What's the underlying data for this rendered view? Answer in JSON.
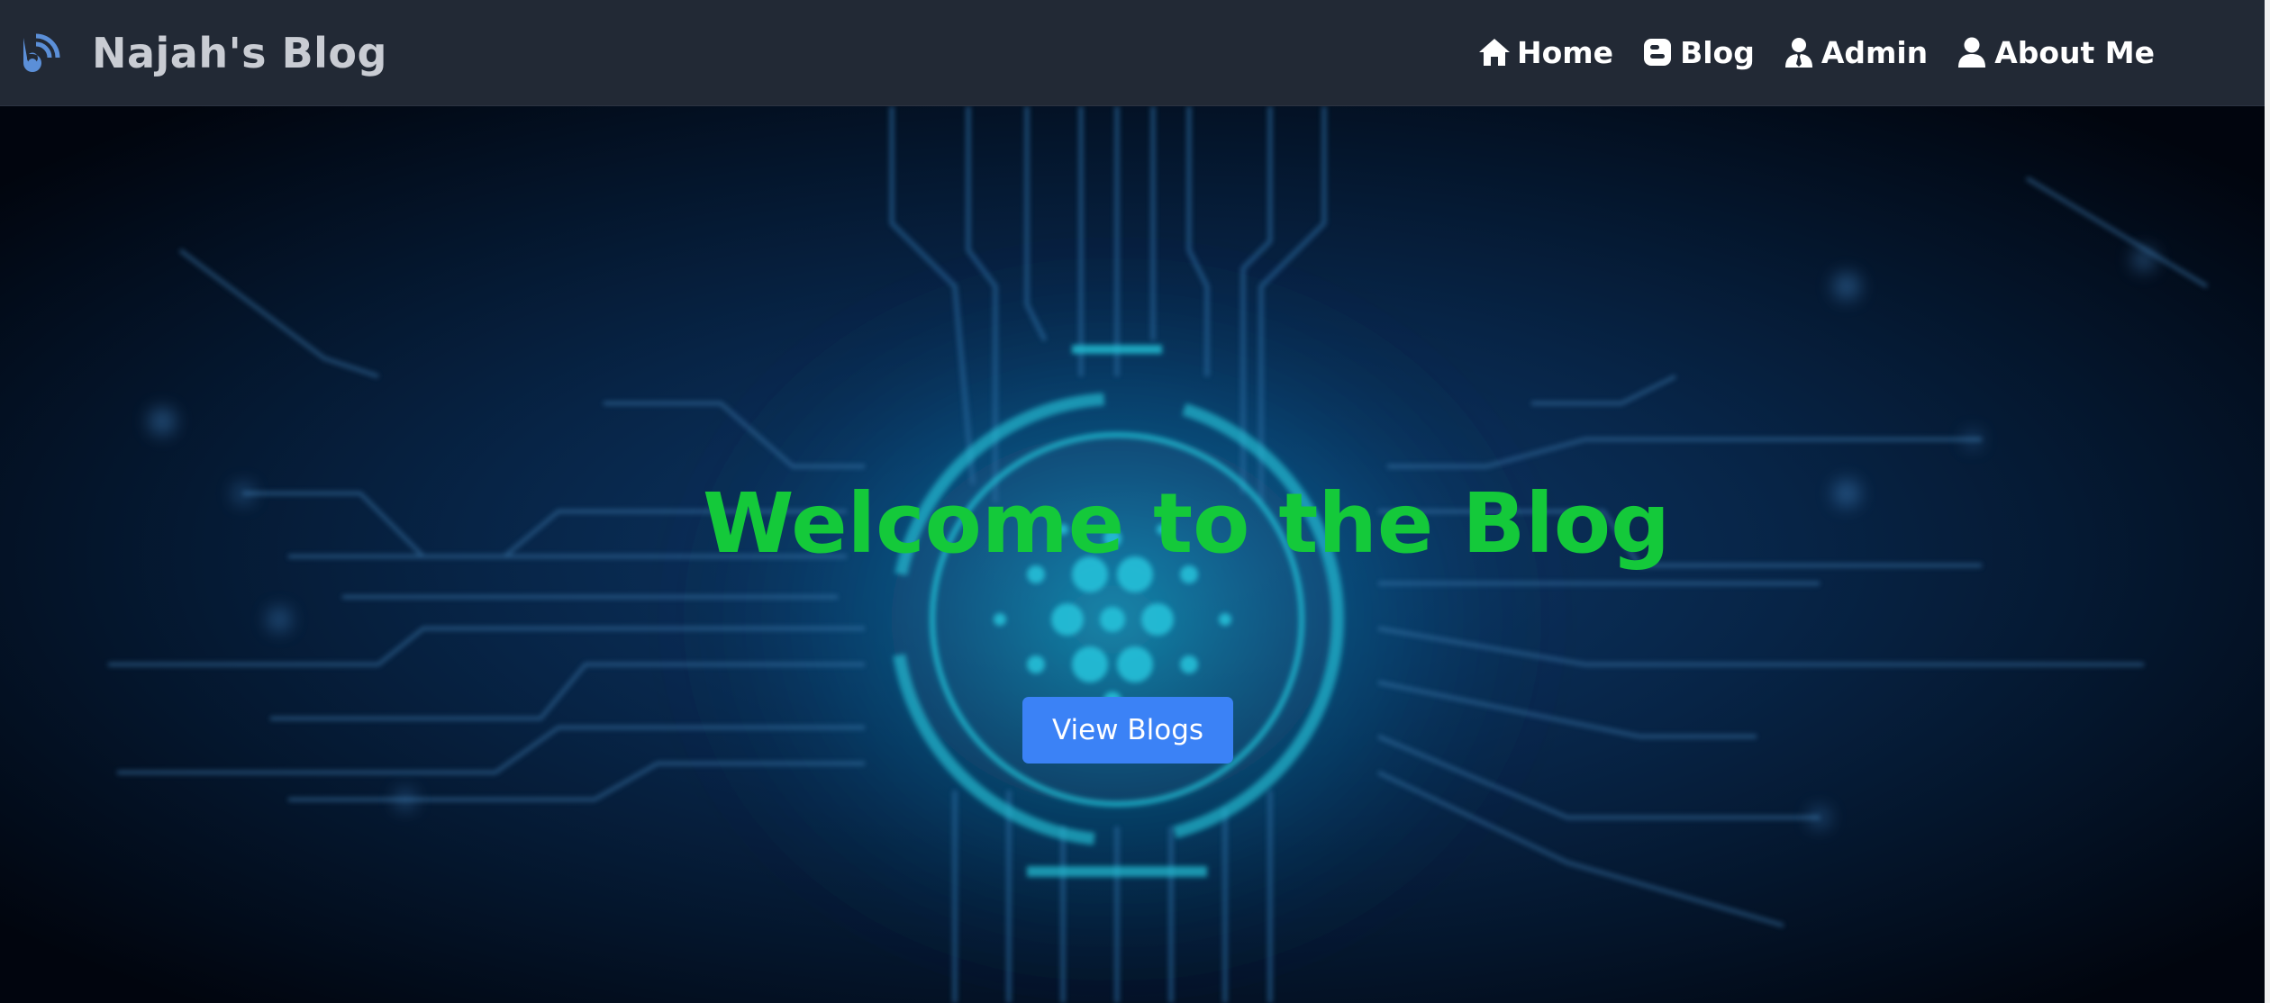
{
  "navbar": {
    "brand_icon": "blog-rss-icon",
    "brand_title": "Najah's Blog",
    "links": [
      {
        "label": "Home",
        "icon": "home-icon"
      },
      {
        "label": "Blog",
        "icon": "blogger-icon"
      },
      {
        "label": "Admin",
        "icon": "user-tie-icon"
      },
      {
        "label": "About Me",
        "icon": "user-icon"
      }
    ]
  },
  "hero": {
    "title": "Welcome to the Blog",
    "button_label": "View Blogs",
    "background": "circuit-board-illustration",
    "colors": {
      "title": "#14c93a",
      "button": "#3b82f6",
      "navbar": "#222935"
    }
  }
}
